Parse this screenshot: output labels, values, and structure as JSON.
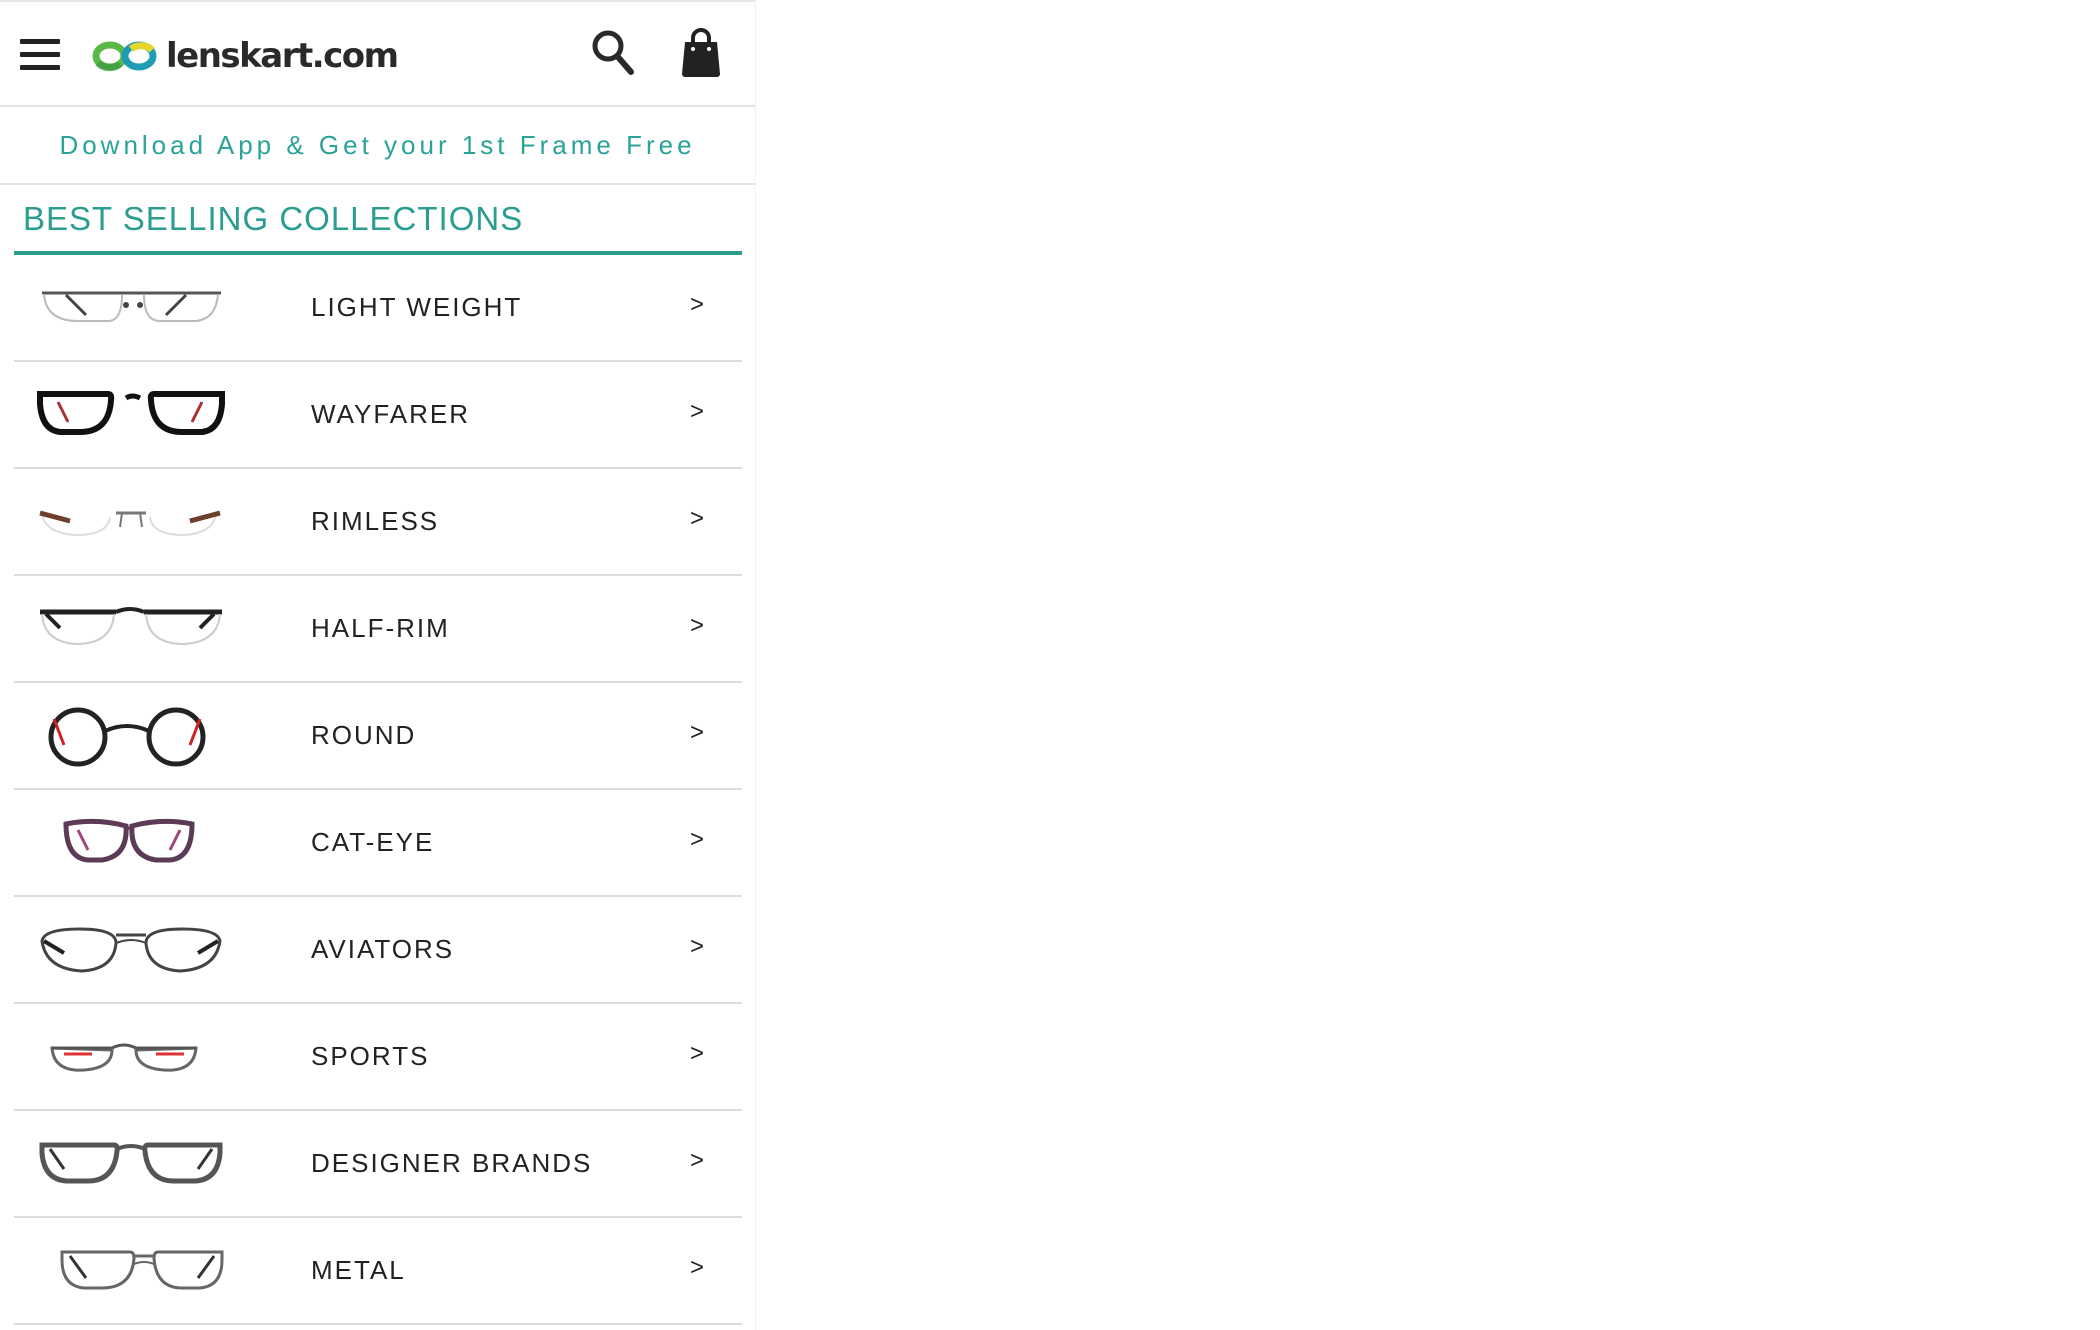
{
  "header": {
    "menu_icon": "hamburger-menu-icon",
    "logo_text": "lenskart.com",
    "logo_icon": "infinity-glasses-logo-icon",
    "search_icon": "search-icon",
    "bag_icon": "shopping-bag-icon"
  },
  "promo": {
    "text": "Download App & Get your 1st Frame Free"
  },
  "section": {
    "title": "BEST SELLING COLLECTIONS"
  },
  "collections": [
    {
      "label": "LIGHT WEIGHT",
      "chevron": ">",
      "icon": "light-weight-glasses-icon"
    },
    {
      "label": "WAYFARER",
      "chevron": ">",
      "icon": "wayfarer-glasses-icon"
    },
    {
      "label": "RIMLESS",
      "chevron": ">",
      "icon": "rimless-glasses-icon"
    },
    {
      "label": "HALF-RIM",
      "chevron": ">",
      "icon": "half-rim-glasses-icon"
    },
    {
      "label": "ROUND",
      "chevron": ">",
      "icon": "round-glasses-icon"
    },
    {
      "label": "CAT-EYE",
      "chevron": ">",
      "icon": "cat-eye-glasses-icon"
    },
    {
      "label": "AVIATORS",
      "chevron": ">",
      "icon": "aviator-glasses-icon"
    },
    {
      "label": "SPORTS",
      "chevron": ">",
      "icon": "sports-glasses-icon"
    },
    {
      "label": "DESIGNER BRANDS",
      "chevron": ">",
      "icon": "designer-glasses-icon"
    },
    {
      "label": "METAL",
      "chevron": ">",
      "icon": "metal-glasses-icon"
    }
  ],
  "colors": {
    "accent": "#2a9d8f",
    "promo_text": "#2aa398",
    "logo_green": "#58b947",
    "logo_teal": "#1f9bb5",
    "logo_yellow": "#e6d62b",
    "text": "#222222",
    "divider": "#dcdcdc"
  }
}
